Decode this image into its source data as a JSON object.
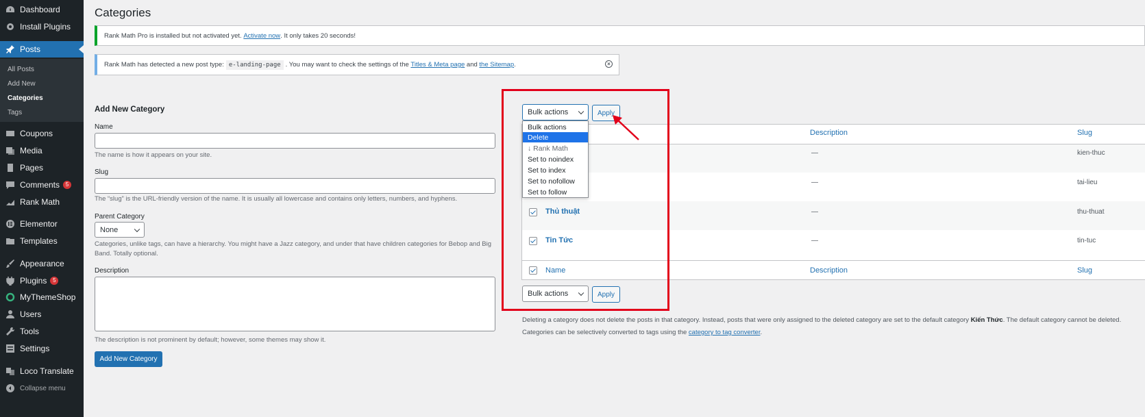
{
  "sidebar": {
    "dashboard": "Dashboard",
    "install_plugins": "Install Plugins",
    "posts": "Posts",
    "sub": [
      "All Posts",
      "Add New",
      "Categories",
      "Tags"
    ],
    "coupons": "Coupons",
    "media": "Media",
    "pages": "Pages",
    "comments": "Comments",
    "comments_badge": "5",
    "rank_math": "Rank Math",
    "elementor": "Elementor",
    "templates": "Templates",
    "appearance": "Appearance",
    "plugins": "Plugins",
    "plugins_badge": "5",
    "mythemeshop": "MyThemeShop",
    "users": "Users",
    "tools": "Tools",
    "settings": "Settings",
    "loco": "Loco Translate",
    "collapse": "Collapse menu"
  },
  "page": {
    "title": "Categories"
  },
  "notice1": {
    "text": "Rank Math Pro is installed but not activated yet.",
    "link": "Activate now",
    "suffix": ". It only takes 20 seconds!"
  },
  "notice2": {
    "text1": "Rank Math has detected a new post type:",
    "code": "e-landing-page",
    "text2": ". You may want to check the settings of the",
    "link1": "Titles & Meta page",
    "and": "and",
    "link2": "the Sitemap",
    "dot": "."
  },
  "form": {
    "heading": "Add New Category",
    "name_label": "Name",
    "name_help": "The name is how it appears on your site.",
    "slug_label": "Slug",
    "slug_help": "The “slug” is the URL-friendly version of the name. It is usually all lowercase and contains only letters, numbers, and hyphens.",
    "parent_label": "Parent Category",
    "parent_value": "None",
    "parent_help": "Categories, unlike tags, can have a hierarchy. You might have a Jazz category, and under that have children categories for Bebop and Big Band. Totally optional.",
    "desc_label": "Description",
    "desc_help": "The description is not prominent by default; however, some themes may show it.",
    "submit": "Add New Category"
  },
  "table": {
    "bulk_label": "Bulk actions",
    "apply": "Apply",
    "col_description": "Description",
    "col_slug": "Slug",
    "col_name": "Name",
    "rows": [
      {
        "name": "",
        "desc": "—",
        "slug": "kien-thuc"
      },
      {
        "name": "",
        "desc": "—",
        "slug": "tai-lieu"
      },
      {
        "name": "Thủ thuật",
        "desc": "—",
        "slug": "thu-thuat"
      },
      {
        "name": "Tin Tức",
        "desc": "—",
        "slug": "tin-tuc"
      }
    ]
  },
  "dropdown": {
    "options": [
      "Bulk actions",
      "Delete",
      "↓ Rank Math",
      "Set to noindex",
      "Set to index",
      "Set to nofollow",
      "Set to follow"
    ]
  },
  "footer": {
    "line1_a": "Deleting a category does not delete the posts in that category. Instead, posts that were only assigned to the deleted category are set to the default category",
    "line1_b": "Kiến Thức",
    "line1_c": ". The default category cannot be deleted.",
    "line2_a": "Categories can be selectively converted to tags using the",
    "line2_link": "category to tag converter",
    "line2_c": "."
  },
  "colors": {
    "accent": "#2271b1",
    "sidebar": "#1d2327",
    "highlight": "#e2001a"
  }
}
